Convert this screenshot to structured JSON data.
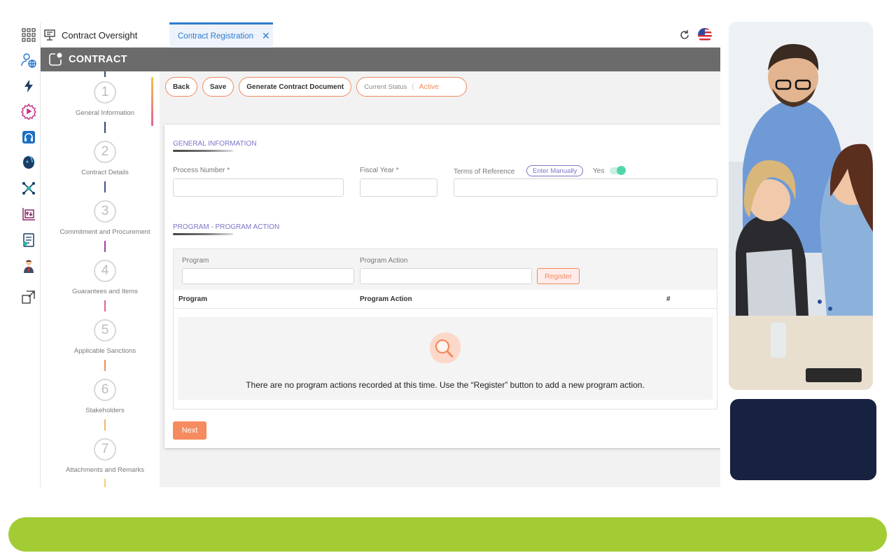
{
  "app": {
    "title": "Contract Oversight",
    "tab_label": "Contract Registration",
    "tab_close": "✕",
    "module_title": "CONTRACT"
  },
  "rail": {
    "icons": [
      "grid-icon",
      "user-globe-icon",
      "lightning-icon",
      "gear-play-icon",
      "headset-icon",
      "robot-icon",
      "network-icon",
      "chart-exchange-icon",
      "document-icon",
      "person-icon",
      "expand-window-icon"
    ]
  },
  "steps": [
    {
      "number": "1",
      "label": "General Information"
    },
    {
      "number": "2",
      "label": "Contract Details"
    },
    {
      "number": "3",
      "label": "Commitment and Procurement"
    },
    {
      "number": "4",
      "label": "Guarantees and Items"
    },
    {
      "number": "5",
      "label": "Applicable Sanctions"
    },
    {
      "number": "6",
      "label": "Stakeholders"
    },
    {
      "number": "7",
      "label": "Attachments and Remarks"
    }
  ],
  "toolbar": {
    "back_label": "Back",
    "save_label": "Save",
    "generate_label": "Generate Contract Document",
    "status_label": "Current Status",
    "status_value": "Active"
  },
  "general": {
    "section_title": "GENERAL INFORMATION",
    "process_number_label": "Process Number *",
    "process_number_value": "",
    "fiscal_year_label": "Fiscal Year *",
    "fiscal_year_value": "",
    "terms_label": "Terms of Reference",
    "terms_button": "Enter Manually",
    "terms_toggle_label": "Yes",
    "terms_toggle_on": true,
    "terms_value": ""
  },
  "program": {
    "section_title": "PROGRAM - PROGRAM ACTION",
    "program_label": "Program",
    "program_value": "",
    "action_label": "Program Action",
    "action_value": "",
    "register_label": "Register",
    "columns": [
      "Program",
      "Program Action",
      "#"
    ],
    "empty_message": "There are no program actions recorded at this time. Use the “Register” button to add a new program action."
  },
  "footer": {
    "next_label": "Next"
  },
  "colors": {
    "accent_orange": "#f08a5d",
    "accent_purple": "#7b76c9",
    "header_gray": "#6b6b6b",
    "tab_blue": "#2e7bd0",
    "toggle_green": "#52d6a8",
    "navy": "#172240",
    "lime": "#a2cb34"
  }
}
